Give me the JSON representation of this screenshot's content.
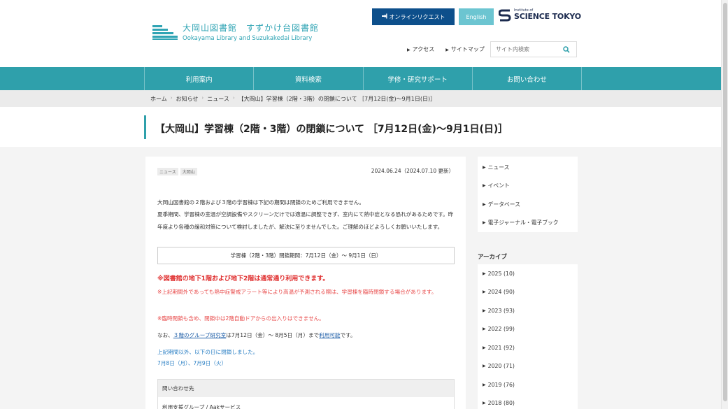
{
  "header": {
    "logo_ja": "大岡山図書館　すずかけ台図書館",
    "logo_en": "Ookayama Library and Suzukakedai Library",
    "online_request": "オンラインリクエスト",
    "english": "English",
    "st_small": "Institute of",
    "st_big": "SCIENCE TOKYO",
    "links": [
      "アクセス",
      "サイトマップ"
    ],
    "search_placeholder": "サイト内検索"
  },
  "nav": [
    "利用案内",
    "資料検索",
    "学修・研究サポート",
    "お問い合わせ"
  ],
  "breadcrumb": [
    "ホーム",
    "お知らせ",
    "ニュース",
    "【大岡山】学習棟（2階・3階）の閉鎖について ［7月12日(金)～9月1日(日)］"
  ],
  "page_title": "【大岡山】学習棟（2階・3階）の閉鎖について ［7月12日(金)～9月1日(日)］",
  "article": {
    "tags": [
      "ニュース",
      "大岡山"
    ],
    "date": "2024.06.24（2024.07.10 更新）",
    "para1": "大岡山図書館の２階および３階の学習棟は下記の期間は閉鎖のためご利用できません。",
    "para2": "夏季期間、学習棟の室温が空調設備やスクリーンだけでは適温に調整できず、室内にて熱中症となる恐れがあるためです。昨年度より各種の緩和対策について検討しましたが、解決に至りませんでした。ご理解のほどよろしくお願いいたします。",
    "period": "学習棟（2階・3階）閉鎖期間：7月12日（金）～ 9月1日（日）",
    "red_bold": "※図書館の地下1階および地下2階は通常通り利用できます。",
    "red1": "※上記期間外であっても熱中症警戒アラート等により高温が予測される際は、学習棟を臨時閉鎖する場合があります。",
    "red2": "※臨時閉鎖も含め、閉鎖中は2階自動ドアからの出入りはできません。",
    "group_pre": "なお、",
    "group_link": "３階のグループ研究室",
    "group_mid": "は7月12日（金）～ 8月5日（月）まで",
    "group_link2": "利用可能",
    "group_post": "です。",
    "blue1": "上記期間以外、以下の日に閉鎖しました。",
    "blue2": "7月8日（月）、7月9日（火）",
    "contact_head": "問い合わせ先",
    "contact_body": "利用支援グループ / Aakサービス"
  },
  "sidebar": {
    "categories": [
      "ニュース",
      "イベント",
      "データベース",
      "電子ジャーナル・電子ブック"
    ],
    "archive_title": "アーカイブ",
    "archives": [
      "2025 (10)",
      "2024 (90)",
      "2023 (93)",
      "2022 (99)",
      "2021 (92)",
      "2020 (71)",
      "2019 (76)",
      "2018 (80)"
    ]
  },
  "colors": {
    "teal": "#2fa0ab",
    "navy": "#0d4f8b",
    "red": "#e03030",
    "blue": "#2a7fc4"
  }
}
